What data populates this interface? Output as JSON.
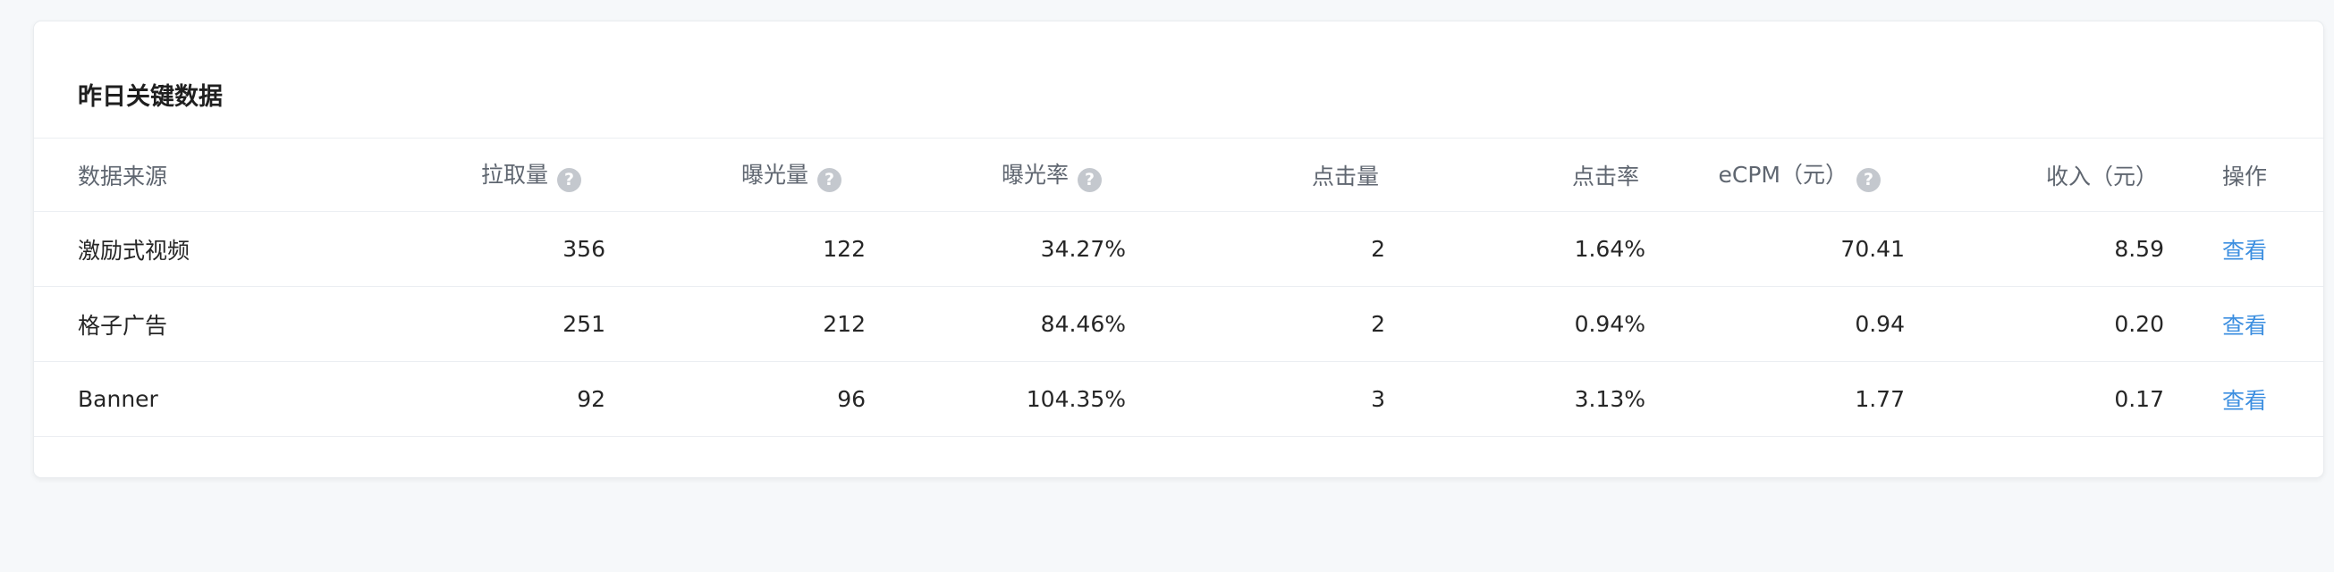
{
  "card": {
    "title": "昨日关键数据"
  },
  "table": {
    "columns": [
      {
        "label": "数据来源",
        "help": false
      },
      {
        "label": "拉取量",
        "help": true
      },
      {
        "label": "曝光量",
        "help": true
      },
      {
        "label": "曝光率",
        "help": true
      },
      {
        "label": "点击量",
        "help": false
      },
      {
        "label": "点击率",
        "help": false
      },
      {
        "label": "eCPM（元）",
        "help": true
      },
      {
        "label": "收入（元）",
        "help": false
      },
      {
        "label": "操作",
        "help": false
      }
    ],
    "help_icon_glyph": "?",
    "rows": [
      {
        "source": "激励式视频",
        "pulls": "356",
        "impressions": "122",
        "impression_rate": "34.27%",
        "clicks": "2",
        "ctr": "1.64%",
        "ecpm": "70.41",
        "revenue": "8.59",
        "action": "查看"
      },
      {
        "source": "格子广告",
        "pulls": "251",
        "impressions": "212",
        "impression_rate": "84.46%",
        "clicks": "2",
        "ctr": "0.94%",
        "ecpm": "0.94",
        "revenue": "0.20",
        "action": "查看"
      },
      {
        "source": "Banner",
        "pulls": "92",
        "impressions": "96",
        "impression_rate": "104.35%",
        "clicks": "3",
        "ctr": "3.13%",
        "ecpm": "1.77",
        "revenue": "0.17",
        "action": "查看"
      }
    ]
  },
  "colors": {
    "link": "#3d8fe0",
    "help_icon_bg": "#c4c8ce"
  }
}
